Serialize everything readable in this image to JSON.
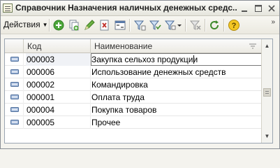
{
  "window": {
    "title": "Справочник Назначения наличных денежных средс..."
  },
  "toolbar": {
    "actions_label": "Действия",
    "more_label": "»",
    "icons": [
      "add-icon",
      "copy-icon",
      "edit-icon",
      "delete-mark-icon",
      "view-mode-icon",
      "filter-icon",
      "filter-by-value-icon",
      "filter-dropdown-icon",
      "clear-filter-icon",
      "refresh-icon",
      "help-icon"
    ]
  },
  "grid": {
    "columns": [
      "Код",
      "Наименование"
    ],
    "rows": [
      {
        "code": "000003",
        "name": "Закупка сельхоз продукции",
        "current": true
      },
      {
        "code": "000006",
        "name": "Использование денежных средств"
      },
      {
        "code": "000002",
        "name": "Командировка"
      },
      {
        "code": "000001",
        "name": "Оплата труда"
      },
      {
        "code": "000004",
        "name": "Покупка товаров"
      },
      {
        "code": "000005",
        "name": "Прочее"
      }
    ]
  }
}
